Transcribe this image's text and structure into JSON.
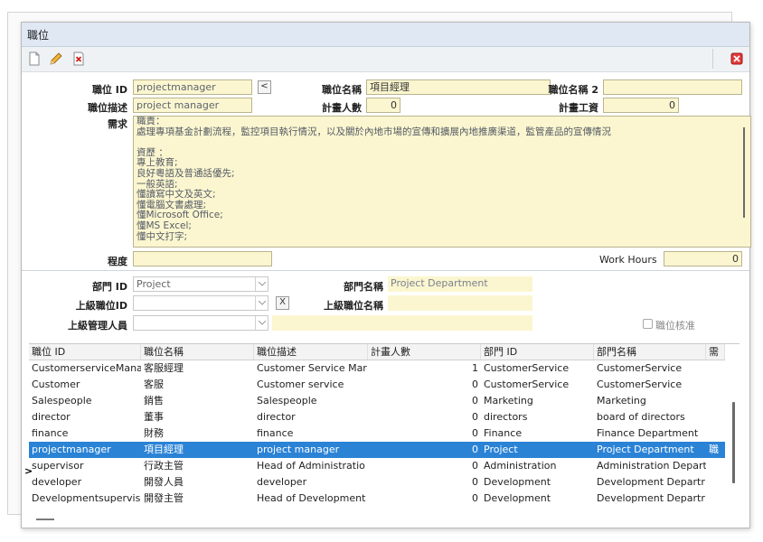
{
  "window": {
    "title": "職位"
  },
  "toolbar": {
    "new_icon": "new-document-icon",
    "edit_icon": "pencil-icon",
    "delete_icon": "delete-icon",
    "close_icon": "close-icon"
  },
  "form": {
    "position_id_label": "職位 ID",
    "position_id_value": "projectmanager",
    "lookup_btn": "<",
    "position_name_label": "職位名稱",
    "position_name_value": "項目經理",
    "position_name2_label": "職位名稱 2",
    "position_name2_value": "",
    "description_label": "職位描述",
    "description_value": "project manager",
    "headcount_label": "計畫人數",
    "headcount_value": "0",
    "salary_label": "計畫工資",
    "salary_value": "0",
    "requirement_label": "需求",
    "requirement_lines": [
      "職責：",
      "處理專項基金計劃流程，監控項目執行情況，以及關於內地市場的宣傳和擴展內地推廣渠道，監管產品的宣傳情況",
      "",
      "資歷 ：",
      "專上教育;",
      "良好粵語及普通話優先;",
      " 一般英語;",
      "懂讀寫中文及英文;",
      " 懂電腦文書處理;",
      "懂Microsoft Office;",
      "懂MS Excel;",
      "懂中文打字;"
    ],
    "level_label": "程度",
    "level_value": "",
    "work_hours_label": "Work Hours",
    "work_hours_value": "0",
    "dept_id_label": "部門 ID",
    "dept_id_value": "Project",
    "dept_name_label": "部門名稱",
    "dept_name_value": "Project Department",
    "parent_position_label": "上級職位ID",
    "parent_position_value": "",
    "clear_btn": "X",
    "parent_name_label": "上級職位名稱",
    "parent_name_value": "",
    "manager_label": "上級管理人員",
    "manager_value": "",
    "approved_label": "職位核准"
  },
  "grid": {
    "headers": [
      "職位 ID",
      "職位名稱",
      "職位描述",
      "計畫人數",
      "部門 ID",
      "部門名稱",
      "需"
    ],
    "rows": [
      {
        "id": "CustomerserviceMana",
        "name": "客服經理",
        "desc": "Customer Service Mar",
        "count": "1",
        "dept": "CustomerService",
        "dept_name": "CustomerService",
        "extra": ""
      },
      {
        "id": "Customer",
        "name": "客服",
        "desc": "Customer service",
        "count": "0",
        "dept": "CustomerService",
        "dept_name": "CustomerService",
        "extra": ""
      },
      {
        "id": "Salespeople",
        "name": "銷售",
        "desc": "Salespeople",
        "count": "0",
        "dept": "Marketing",
        "dept_name": "Marketing",
        "extra": ""
      },
      {
        "id": "director",
        "name": "董事",
        "desc": "director",
        "count": "0",
        "dept": "directors",
        "dept_name": "board of directors",
        "extra": ""
      },
      {
        "id": "finance",
        "name": "財務",
        "desc": "finance",
        "count": "0",
        "dept": "Finance",
        "dept_name": "Finance Department",
        "extra": ""
      },
      {
        "id": "projectmanager",
        "name": "項目經理",
        "desc": "project manager",
        "count": "0",
        "dept": "Project",
        "dept_name": "Project Department",
        "extra": "職"
      },
      {
        "id": "supervisor",
        "name": "行政主管",
        "desc": "Head of Administratio",
        "count": "0",
        "dept": "Administration",
        "dept_name": "Administration Depart",
        "extra": ""
      },
      {
        "id": "developer",
        "name": "開發人員",
        "desc": "developer",
        "count": "0",
        "dept": "Development",
        "dept_name": "Development Departr",
        "extra": ""
      },
      {
        "id": "Developmentsupervis",
        "name": "開發主管",
        "desc": "Head of Development",
        "count": "0",
        "dept": "Development",
        "dept_name": "Development Departr",
        "extra": ""
      }
    ],
    "selected_index": 5,
    "row_indicator": ">"
  }
}
